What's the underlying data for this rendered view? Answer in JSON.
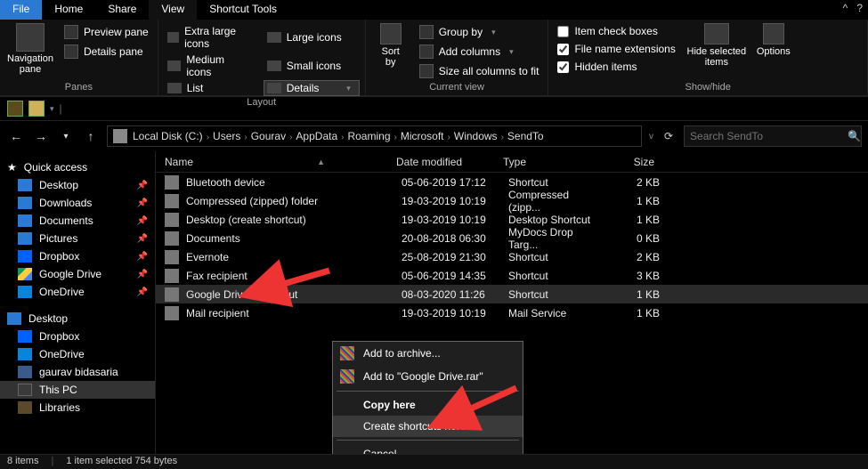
{
  "menubar": {
    "file": "File",
    "tabs": [
      "Home",
      "Share",
      "View"
    ],
    "context_tab": "Shortcut Tools",
    "active": "View"
  },
  "ribbon": {
    "panes": {
      "nav_label": "Navigation\npane",
      "preview": "Preview pane",
      "details": "Details pane",
      "group_label": "Panes"
    },
    "layout": {
      "items": [
        "Extra large icons",
        "Large icons",
        "Medium icons",
        "Small icons",
        "List",
        "Details"
      ],
      "selected": "Details",
      "group_label": "Layout"
    },
    "current": {
      "sort_label": "Sort\nby",
      "group_by": "Group by",
      "add_cols": "Add columns",
      "fit_cols": "Size all columns to fit",
      "group_label": "Current view"
    },
    "showhide": {
      "check_boxes": "Item check boxes",
      "extensions": "File name extensions",
      "hidden": "Hidden items",
      "hide_btn": "Hide selected\nitems",
      "options": "Options",
      "group_label": "Show/hide"
    }
  },
  "breadcrumb": [
    "Local Disk (C:)",
    "Users",
    "Gourav",
    "AppData",
    "Roaming",
    "Microsoft",
    "Windows",
    "SendTo"
  ],
  "search_placeholder": "Search SendTo",
  "columns": {
    "name": "Name",
    "date": "Date modified",
    "type": "Type",
    "size": "Size"
  },
  "rows": [
    {
      "name": "Bluetooth device",
      "date": "05-06-2019 17:12",
      "type": "Shortcut",
      "size": "2 KB"
    },
    {
      "name": "Compressed (zipped) folder",
      "date": "19-03-2019 10:19",
      "type": "Compressed (zipp...",
      "size": "1 KB"
    },
    {
      "name": "Desktop (create shortcut)",
      "date": "19-03-2019 10:19",
      "type": "Desktop Shortcut",
      "size": "1 KB"
    },
    {
      "name": "Documents",
      "date": "20-08-2018 06:30",
      "type": "MyDocs Drop Targ...",
      "size": "0 KB"
    },
    {
      "name": "Evernote",
      "date": "25-08-2019 21:30",
      "type": "Shortcut",
      "size": "2 KB"
    },
    {
      "name": "Fax recipient",
      "date": "05-06-2019 14:35",
      "type": "Shortcut",
      "size": "3 KB"
    },
    {
      "name": "Google Drive - Shortcut",
      "date": "08-03-2020 11:26",
      "type": "Shortcut",
      "size": "1 KB",
      "selected": true
    },
    {
      "name": "Mail recipient",
      "date": "19-03-2019 10:19",
      "type": "Mail Service",
      "size": "1 KB"
    }
  ],
  "sidebar": {
    "quick": {
      "label": "Quick access",
      "items": [
        {
          "label": "Desktop",
          "pin": true,
          "ico": "ico-blue"
        },
        {
          "label": "Downloads",
          "pin": true,
          "ico": "ico-blue"
        },
        {
          "label": "Documents",
          "pin": true,
          "ico": "ico-blue"
        },
        {
          "label": "Pictures",
          "pin": true,
          "ico": "ico-blue"
        },
        {
          "label": "Dropbox",
          "pin": true,
          "ico": "ico-dropbox"
        },
        {
          "label": "Google Drive",
          "pin": true,
          "ico": "ico-gdrive"
        },
        {
          "label": "OneDrive",
          "pin": true,
          "ico": "ico-onedrive"
        }
      ]
    },
    "desktop": {
      "label": "Desktop",
      "items": [
        {
          "label": "Dropbox",
          "ico": "ico-dropbox"
        },
        {
          "label": "OneDrive",
          "ico": "ico-onedrive"
        },
        {
          "label": "gaurav bidasaria",
          "ico": "ico-user"
        },
        {
          "label": "This PC",
          "ico": "ico-pc",
          "selected": true
        },
        {
          "label": "Libraries",
          "ico": "ico-lib"
        }
      ]
    }
  },
  "context_menu": {
    "items": [
      {
        "label": "Add to archive...",
        "ico": "rar"
      },
      {
        "label": "Add to \"Google Drive.rar\"",
        "ico": "rar"
      },
      {
        "label": "Copy here",
        "bold": true
      },
      {
        "label": "Create shortcuts here",
        "hover": true
      },
      {
        "label": "Cancel"
      }
    ]
  },
  "status": {
    "items": "8 items",
    "selection": "1 item selected  754 bytes"
  }
}
